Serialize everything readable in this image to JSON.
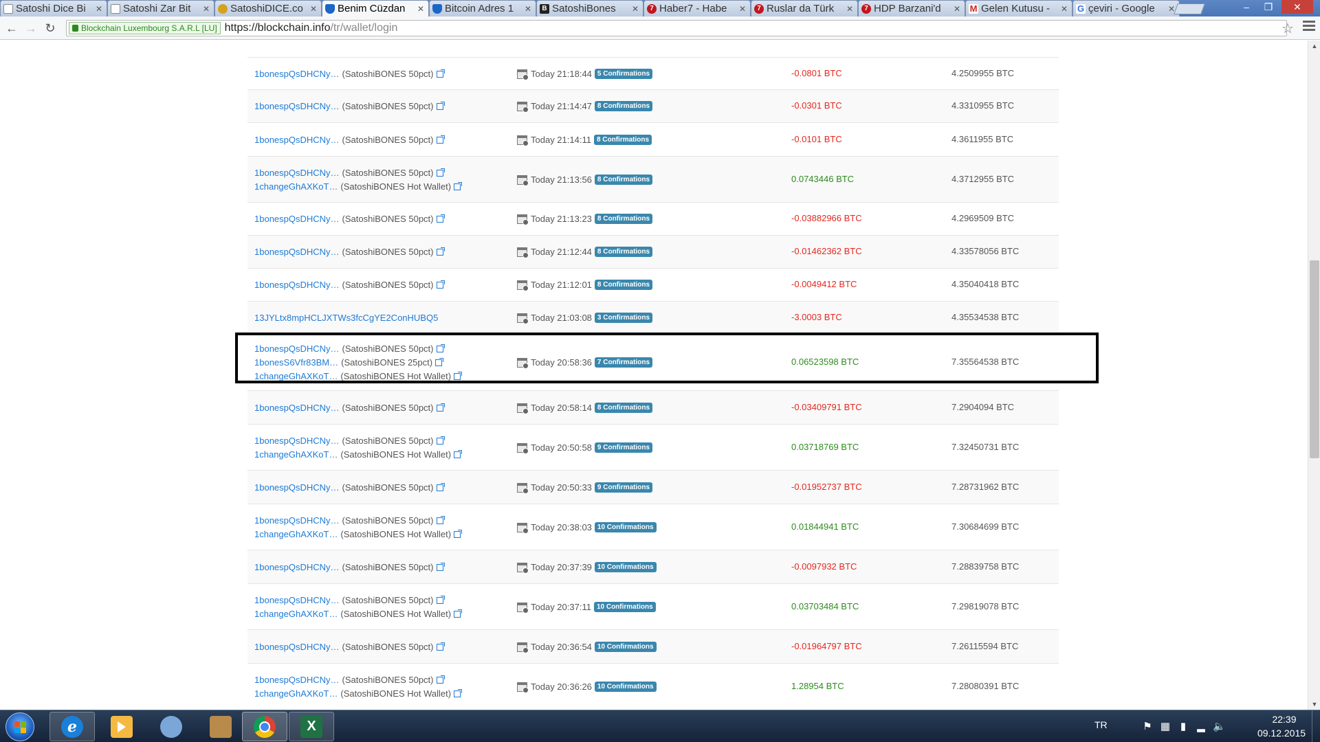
{
  "browser": {
    "tabs": [
      {
        "title": "Satoshi Dice Bi",
        "icon": "doc"
      },
      {
        "title": "Satoshi Zar Bit",
        "icon": "doc"
      },
      {
        "title": "SatoshiDICE.co",
        "icon": "coin"
      },
      {
        "title": "Benim Cüzdan",
        "icon": "shield",
        "active": true
      },
      {
        "title": "Bitcoin Adres 1",
        "icon": "shield"
      },
      {
        "title": "SatoshiBones",
        "icon": "bones"
      },
      {
        "title": "Haber7 - Habe",
        "icon": "h7"
      },
      {
        "title": "Ruslar da Türk",
        "icon": "h7"
      },
      {
        "title": "HDP Barzani'd",
        "icon": "h7"
      },
      {
        "title": "Gelen Kutusu -",
        "icon": "gm"
      },
      {
        "title": "çeviri - Google",
        "icon": "g"
      }
    ],
    "ev_label": "Blockchain Luxembourg S.A.R.L [LU]",
    "url_scheme_host": "https://blockchain.info",
    "url_path": "/tr/wallet/login"
  },
  "transactions": [
    {
      "addresses": [
        {
          "addr": "1bonespQsDHCNy…",
          "label": "(SatoshiBONES 50pct)"
        }
      ],
      "time": "Today 21:18:44",
      "confirmations": "5 Confirmations",
      "amount": "-0.0801 BTC",
      "balance": "4.2509955 BTC"
    },
    {
      "addresses": [
        {
          "addr": "1bonespQsDHCNy…",
          "label": "(SatoshiBONES 50pct)"
        }
      ],
      "time": "Today 21:14:47",
      "confirmations": "8 Confirmations",
      "amount": "-0.0301 BTC",
      "balance": "4.3310955 BTC"
    },
    {
      "addresses": [
        {
          "addr": "1bonespQsDHCNy…",
          "label": "(SatoshiBONES 50pct)"
        }
      ],
      "time": "Today 21:14:11",
      "confirmations": "8 Confirmations",
      "amount": "-0.0101 BTC",
      "balance": "4.3611955 BTC"
    },
    {
      "addresses": [
        {
          "addr": "1bonespQsDHCNy…",
          "label": "(SatoshiBONES 50pct)"
        },
        {
          "addr": "1changeGhAXKoT…",
          "label": "(SatoshiBONES Hot Wallet)"
        }
      ],
      "time": "Today 21:13:56",
      "confirmations": "8 Confirmations",
      "amount": "0.0743446 BTC",
      "balance": "4.3712955 BTC"
    },
    {
      "addresses": [
        {
          "addr": "1bonespQsDHCNy…",
          "label": "(SatoshiBONES 50pct)"
        }
      ],
      "time": "Today 21:13:23",
      "confirmations": "8 Confirmations",
      "amount": "-0.03882966 BTC",
      "balance": "4.2969509 BTC"
    },
    {
      "addresses": [
        {
          "addr": "1bonespQsDHCNy…",
          "label": "(SatoshiBONES 50pct)"
        }
      ],
      "time": "Today 21:12:44",
      "confirmations": "8 Confirmations",
      "amount": "-0.01462362 BTC",
      "balance": "4.33578056 BTC"
    },
    {
      "addresses": [
        {
          "addr": "1bonespQsDHCNy…",
          "label": "(SatoshiBONES 50pct)"
        }
      ],
      "time": "Today 21:12:01",
      "confirmations": "8 Confirmations",
      "amount": "-0.0049412 BTC",
      "balance": "4.35040418 BTC"
    },
    {
      "addresses": [
        {
          "addr": "13JYLtx8mpHCLJXTWs3fcCgYE2ConHUBQ5",
          "label": ""
        }
      ],
      "time": "Today 21:03:08",
      "confirmations": "3 Confirmations",
      "amount": "-3.0003 BTC",
      "balance": "4.35534538 BTC"
    },
    {
      "addresses": [
        {
          "addr": "1bonespQsDHCNy…",
          "label": "(SatoshiBONES 50pct)"
        },
        {
          "addr": "1bonesS6Vfr83BM…",
          "label": "(SatoshiBONES 25pct)"
        },
        {
          "addr": "1changeGhAXKoT…",
          "label": "(SatoshiBONES Hot Wallet)"
        }
      ],
      "time": "Today 20:58:36",
      "confirmations": "7 Confirmations",
      "amount": "0.06523598 BTC",
      "balance": "7.35564538 BTC"
    },
    {
      "addresses": [
        {
          "addr": "1bonespQsDHCNy…",
          "label": "(SatoshiBONES 50pct)"
        }
      ],
      "time": "Today 20:58:14",
      "confirmations": "8 Confirmations",
      "amount": "-0.03409791 BTC",
      "balance": "7.2904094 BTC"
    },
    {
      "addresses": [
        {
          "addr": "1bonespQsDHCNy…",
          "label": "(SatoshiBONES 50pct)"
        },
        {
          "addr": "1changeGhAXKoT…",
          "label": "(SatoshiBONES Hot Wallet)"
        }
      ],
      "time": "Today 20:50:58",
      "confirmations": "9 Confirmations",
      "amount": "0.03718769 BTC",
      "balance": "7.32450731 BTC"
    },
    {
      "addresses": [
        {
          "addr": "1bonespQsDHCNy…",
          "label": "(SatoshiBONES 50pct)"
        }
      ],
      "time": "Today 20:50:33",
      "confirmations": "9 Confirmations",
      "amount": "-0.01952737 BTC",
      "balance": "7.28731962 BTC"
    },
    {
      "addresses": [
        {
          "addr": "1bonespQsDHCNy…",
          "label": "(SatoshiBONES 50pct)"
        },
        {
          "addr": "1changeGhAXKoT…",
          "label": "(SatoshiBONES Hot Wallet)"
        }
      ],
      "time": "Today 20:38:03",
      "confirmations": "10 Confirmations",
      "amount": "0.01844941 BTC",
      "balance": "7.30684699 BTC"
    },
    {
      "addresses": [
        {
          "addr": "1bonespQsDHCNy…",
          "label": "(SatoshiBONES 50pct)"
        }
      ],
      "time": "Today 20:37:39",
      "confirmations": "10 Confirmations",
      "amount": "-0.0097932 BTC",
      "balance": "7.28839758 BTC"
    },
    {
      "addresses": [
        {
          "addr": "1bonespQsDHCNy…",
          "label": "(SatoshiBONES 50pct)"
        },
        {
          "addr": "1changeGhAXKoT…",
          "label": "(SatoshiBONES Hot Wallet)"
        }
      ],
      "time": "Today 20:37:11",
      "confirmations": "10 Confirmations",
      "amount": "0.03703484 BTC",
      "balance": "7.29819078 BTC"
    },
    {
      "addresses": [
        {
          "addr": "1bonespQsDHCNy…",
          "label": "(SatoshiBONES 50pct)"
        }
      ],
      "time": "Today 20:36:54",
      "confirmations": "10 Confirmations",
      "amount": "-0.01964797 BTC",
      "balance": "7.26115594 BTC"
    },
    {
      "addresses": [
        {
          "addr": "1bonespQsDHCNy…",
          "label": "(SatoshiBONES 50pct)"
        },
        {
          "addr": "1changeGhAXKoT…",
          "label": "(SatoshiBONES Hot Wallet)"
        }
      ],
      "time": "Today 20:36:26",
      "confirmations": "10 Confirmations",
      "amount": "1.28954 BTC",
      "balance": "7.28080391 BTC"
    }
  ],
  "colors": {
    "negative": "#e4281f",
    "positive": "#2e8b1e",
    "link": "#1e7bd6",
    "badge": "#3a87ad"
  },
  "taskbar": {
    "apps": [
      "internet-explorer",
      "media-player",
      "messenger",
      "archive-manager",
      "google-chrome",
      "microsoft-excel"
    ],
    "language": "TR",
    "time": "22:39",
    "date": "09.12.2015"
  }
}
